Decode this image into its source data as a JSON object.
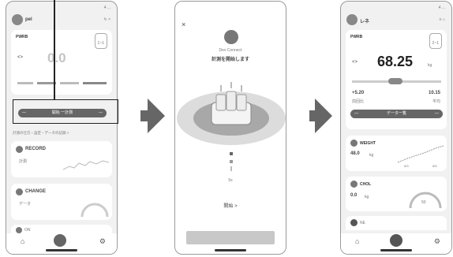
{
  "phone1": {
    "header_user": "pel",
    "status_bar": "4 ...",
    "header_right": "↻ ×",
    "card1_label": "PWRB",
    "card1_pill": "1~1",
    "card1_value": "0.0",
    "start_button_left": "—",
    "start_button_label": "開始 一計測",
    "start_button_right": "—",
    "row_text": "計測の仕方・設定・データの記録 >",
    "card2_title": "RECORD",
    "card2_sub": "計測",
    "card3_title": "CHANGE",
    "card3_sub": "データ",
    "card4_title": "ON"
  },
  "phone2": {
    "close": "×",
    "device_label": "Dev Connect",
    "title": "計測を開始します",
    "count_label": "5s",
    "bottom_label": "開始 >"
  },
  "phone3": {
    "header_user": "レネ",
    "status_bar": "4 ...",
    "header_right": "≡ ⌂",
    "card1_label": "PWRB",
    "card1_pill": "2~1",
    "big_value": "68.25",
    "big_unit": "kg",
    "left_value": "+5.20",
    "left_caption": "前回比",
    "right_value": "10.15",
    "right_caption": "平均",
    "button_left": "—",
    "button_label": "データ一覧",
    "button_right": "—",
    "card2_title": "WEIGHT",
    "card2_value": "48.0",
    "card2_unit": "kg",
    "card2_axis_a": "5/3",
    "card2_axis_b": "5/5",
    "card3_title": "CHOL",
    "card3_value": "0.0",
    "card3_unit": "kg",
    "card3_gauge": "50",
    "card4_title": "NE"
  }
}
